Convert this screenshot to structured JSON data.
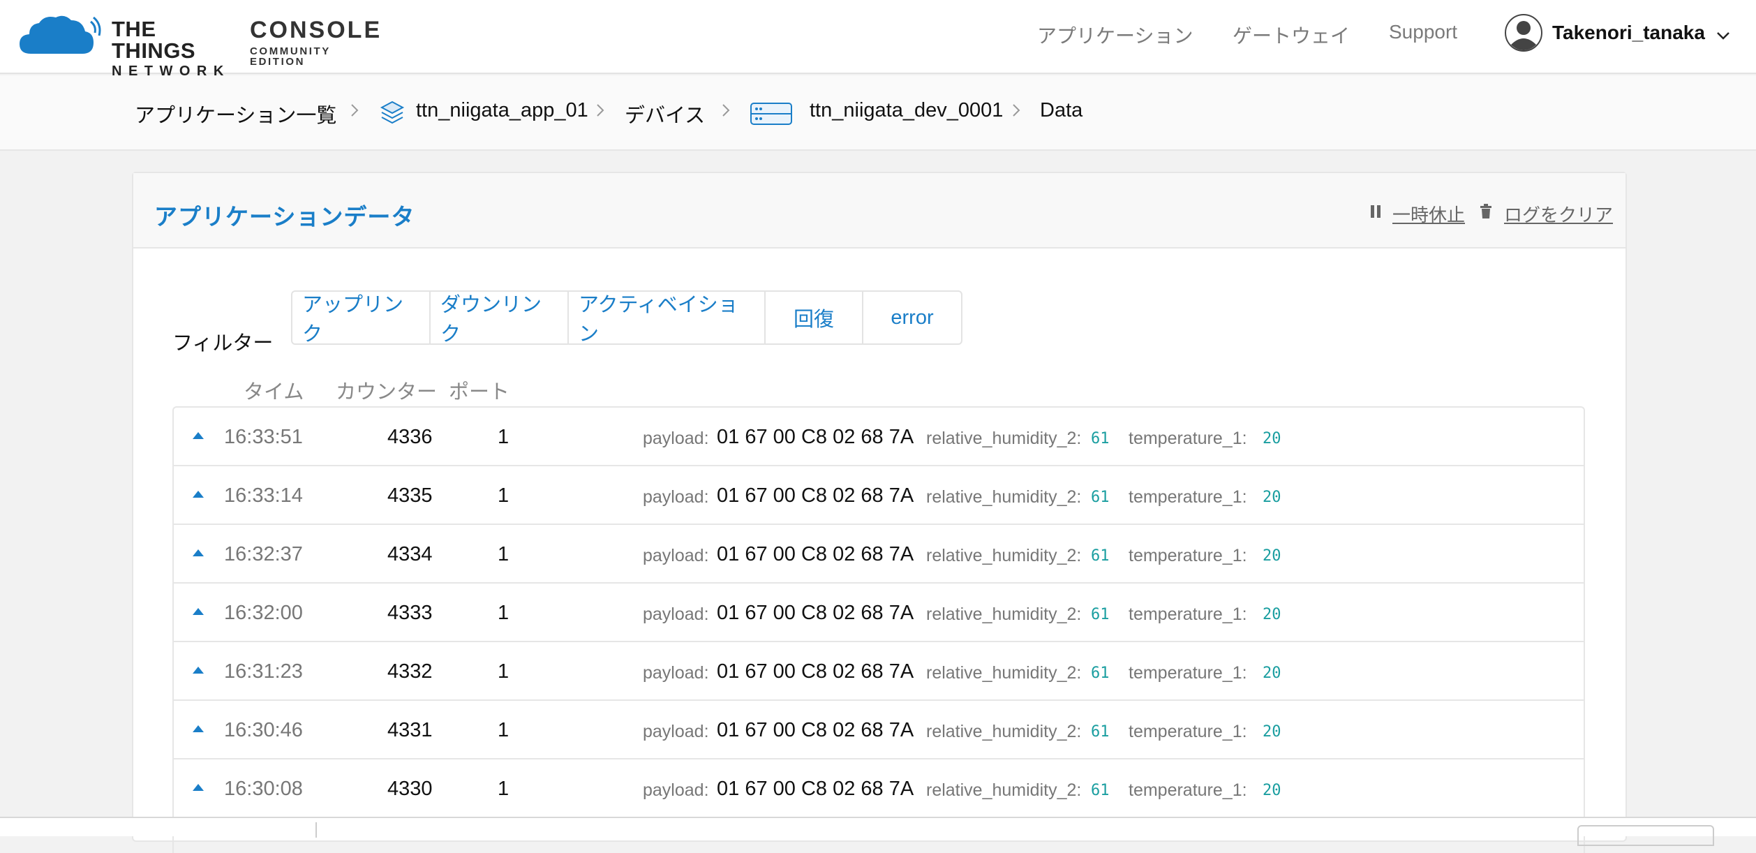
{
  "brand": {
    "ttn_line1": "THE THINGS",
    "ttn_line2": "NETWORK",
    "console_line1": "CONSOLE",
    "console_line2": "COMMUNITY EDITION",
    "accent_color": "#1a7ec8"
  },
  "nav": {
    "applications": "アプリケーション",
    "gateways": "ゲートウェイ",
    "support": "Support",
    "username": "Takenori_tanaka"
  },
  "breadcrumb": {
    "app_list": "アプリケーション一覧",
    "app": "ttn_niigata_app_01",
    "devices": "デバイス",
    "device": "ttn_niigata_dev_0001",
    "current": "Data"
  },
  "card": {
    "title": "アプリケーションデータ",
    "pause": "一時休止",
    "clear_log": "ログをクリア"
  },
  "filter": {
    "label": "フィルター",
    "options": [
      "アップリンク",
      "ダウンリンク",
      "アクティベイション",
      "回復",
      "error"
    ]
  },
  "columns": {
    "time": "タイム",
    "counter": "カウンター",
    "port": "ポート"
  },
  "rows": [
    {
      "time": "16:33:51",
      "counter": "4336",
      "port": "1",
      "payload_label": "payload:",
      "payload": "01 67 00 C8 02 68 7A",
      "k1": "relative_humidity_2:",
      "v1": "61",
      "k2": "temperature_1:",
      "v2": "20"
    },
    {
      "time": "16:33:14",
      "counter": "4335",
      "port": "1",
      "payload_label": "payload:",
      "payload": "01 67 00 C8 02 68 7A",
      "k1": "relative_humidity_2:",
      "v1": "61",
      "k2": "temperature_1:",
      "v2": "20"
    },
    {
      "time": "16:32:37",
      "counter": "4334",
      "port": "1",
      "payload_label": "payload:",
      "payload": "01 67 00 C8 02 68 7A",
      "k1": "relative_humidity_2:",
      "v1": "61",
      "k2": "temperature_1:",
      "v2": "20"
    },
    {
      "time": "16:32:00",
      "counter": "4333",
      "port": "1",
      "payload_label": "payload:",
      "payload": "01 67 00 C8 02 68 7A",
      "k1": "relative_humidity_2:",
      "v1": "61",
      "k2": "temperature_1:",
      "v2": "20"
    },
    {
      "time": "16:31:23",
      "counter": "4332",
      "port": "1",
      "payload_label": "payload:",
      "payload": "01 67 00 C8 02 68 7A",
      "k1": "relative_humidity_2:",
      "v1": "61",
      "k2": "temperature_1:",
      "v2": "20"
    },
    {
      "time": "16:30:46",
      "counter": "4331",
      "port": "1",
      "payload_label": "payload:",
      "payload": "01 67 00 C8 02 68 7A",
      "k1": "relative_humidity_2:",
      "v1": "61",
      "k2": "temperature_1:",
      "v2": "20"
    },
    {
      "time": "16:30:08",
      "counter": "4330",
      "port": "1",
      "payload_label": "payload:",
      "payload": "01 67 00 C8 02 68 7A",
      "k1": "relative_humidity_2:",
      "v1": "61",
      "k2": "temperature_1:",
      "v2": "20"
    }
  ]
}
